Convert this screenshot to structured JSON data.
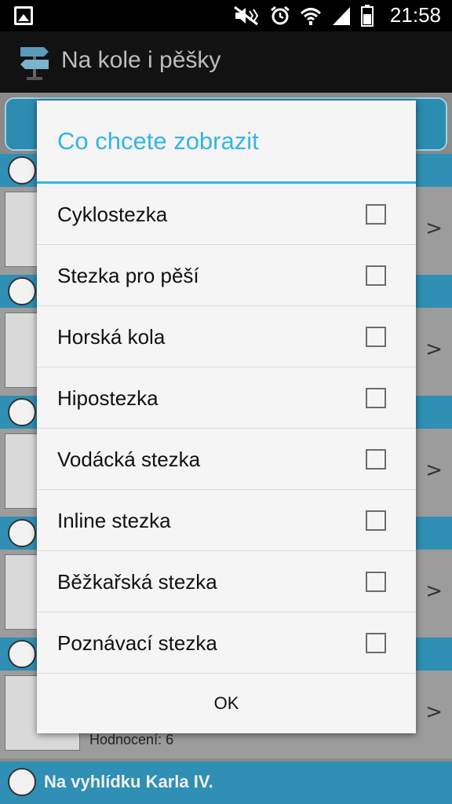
{
  "status_bar": {
    "time": "21:58",
    "icons": [
      "gallery-icon",
      "mute-icon",
      "alarm-icon",
      "wifi-icon",
      "signal-icon",
      "battery-icon"
    ]
  },
  "app_bar": {
    "title": "Na kole i pěšky",
    "icon": "signpost-icon"
  },
  "background": {
    "rating_text": "Hodnocení: 6",
    "footer_item": "Na vyhlídku Karla IV."
  },
  "dialog": {
    "title": "Co chcete zobrazit",
    "options": [
      {
        "label": "Cyklostezka",
        "checked": false
      },
      {
        "label": "Stezka pro pěší",
        "checked": false
      },
      {
        "label": "Horská kola",
        "checked": false
      },
      {
        "label": "Hipostezka",
        "checked": false
      },
      {
        "label": "Vodácká stezka",
        "checked": false
      },
      {
        "label": "Inline stezka",
        "checked": false
      },
      {
        "label": "Běžkařská stezka",
        "checked": false
      },
      {
        "label": "Poznávací stezka",
        "checked": false
      }
    ],
    "ok_label": "OK"
  },
  "colors": {
    "accent": "#33b5e5",
    "list_header": "#2f8fb4"
  }
}
